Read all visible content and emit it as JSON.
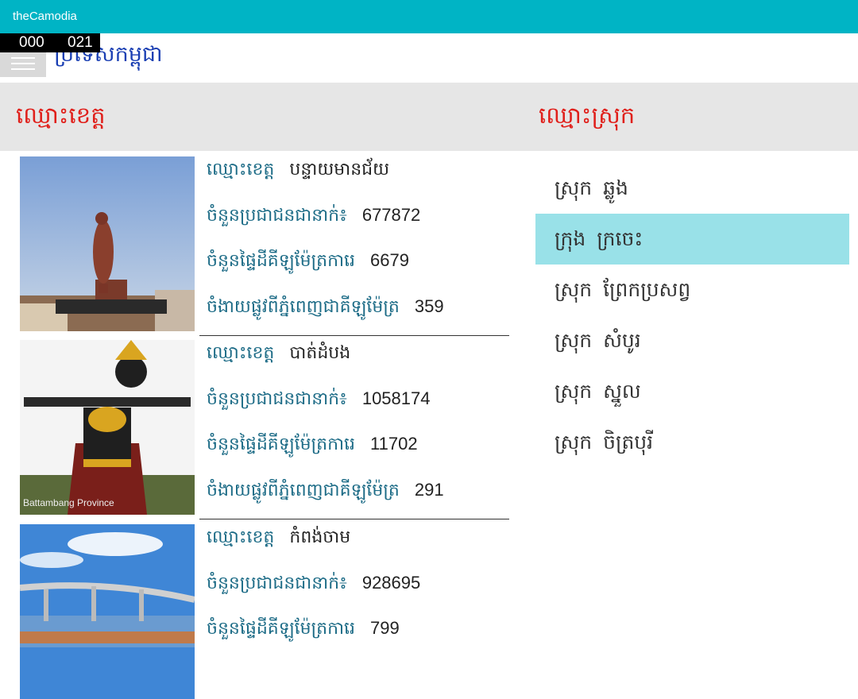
{
  "app": {
    "title": "theCamodia"
  },
  "counter": {
    "left": "000",
    "right": "021"
  },
  "page": {
    "title": "ប្រទេសកម្ពុជា"
  },
  "headers": {
    "province_col": "ឈ្មោះខេត្ត",
    "district_col": "ឈ្មោះស្រុក"
  },
  "labels": {
    "name": "ឈ្មោះខេត្ត",
    "population": "ចំនួនប្រជាជនជានាក់៖",
    "area": "ចំនួនផ្ទៃដីគីឡូម៉ែត្រការេ",
    "distance": "ចំងាយផ្លូវពីភ្នំពេញជាគីឡូម៉ែត្រ"
  },
  "provinces": [
    {
      "name": "បន្ទាយមានជ័យ",
      "population": "677872",
      "area": "6679",
      "distance": "359",
      "image_icon": "statue-photo"
    },
    {
      "name": "បាត់ដំបង",
      "population": "1058174",
      "area": "11702",
      "distance": "291",
      "image_icon": "ta-dambong-statue-photo",
      "watermark": "Battambang Province"
    },
    {
      "name": "កំពង់ចាម",
      "population": "928695",
      "area": "799",
      "distance": "",
      "image_icon": "bridge-photo"
    }
  ],
  "districts": [
    {
      "kind": "ស្រុក",
      "name": "ឆ្លូង",
      "selected": false
    },
    {
      "kind": "ក្រុង",
      "name": "ក្រចេះ",
      "selected": true
    },
    {
      "kind": "ស្រុក",
      "name": "ព្រែកប្រសព្វ",
      "selected": false
    },
    {
      "kind": "ស្រុក",
      "name": "សំបូរ",
      "selected": false
    },
    {
      "kind": "ស្រុក",
      "name": "ស្នួល",
      "selected": false
    },
    {
      "kind": "ស្រុក",
      "name": "ចិត្របុរី",
      "selected": false
    }
  ],
  "colors": {
    "titlebar": "#00b4c5",
    "header_text": "#e0201b",
    "selected": "#99e1e8",
    "label": "#1c6b86"
  }
}
